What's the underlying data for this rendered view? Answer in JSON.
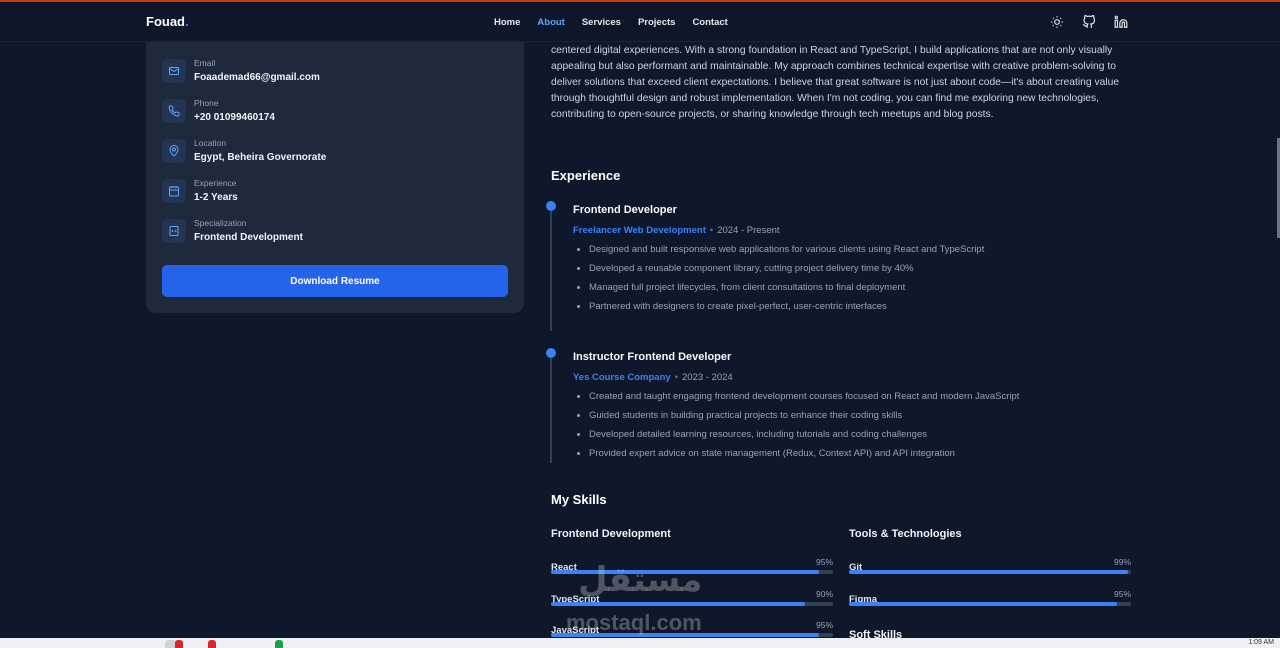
{
  "header": {
    "logo": "Fouad",
    "nav": [
      "Home",
      "About",
      "Services",
      "Projects",
      "Contact"
    ],
    "active_nav": "About",
    "icons": [
      "sun-icon",
      "github-icon",
      "linkedin-icon"
    ]
  },
  "contact": [
    {
      "label": "Email",
      "value": "Foaademad66@gmail.com",
      "icon": "mail-icon"
    },
    {
      "label": "Phone",
      "value": "+20 01099460174",
      "icon": "phone-icon"
    },
    {
      "label": "Location",
      "value": "Egypt, Beheira Governorate",
      "icon": "map-pin-icon"
    },
    {
      "label": "Experience",
      "value": "1-2 Years",
      "icon": "calendar-icon"
    },
    {
      "label": "Specialization",
      "value": "Frontend Development",
      "icon": "code-icon"
    }
  ],
  "download_button": "Download Resume",
  "bio": "centered digital experiences. With a strong foundation in React and TypeScript, I build applications that are not only visually appealing but also performant and maintainable. My approach combines technical expertise with creative problem-solving to deliver solutions that exceed client expectations. I believe that great software is not just about code—it's about creating value through thoughtful design and robust implementation. When I'm not coding, you can find me exploring new technologies, contributing to open-source projects, or sharing knowledge through tech meetups and blog posts.",
  "experience": {
    "heading": "Experience",
    "jobs": [
      {
        "title": "Frontend Developer",
        "company": "Freelancer Web Development",
        "period": "2024 - Present",
        "bullets": [
          "Designed and built responsive web applications for various clients using React and TypeScript",
          "Developed a reusable component library, cutting project delivery time by 40%",
          "Managed full project lifecycles, from client consultations to final deployment",
          "Partnered with designers to create pixel-perfect, user-centric interfaces"
        ]
      },
      {
        "title": "Instructor Frontend Developer",
        "company": "Yes Course Company",
        "period": "2023 - 2024",
        "bullets": [
          "Created and taught engaging frontend development courses focused on React and modern JavaScript",
          "Guided students in building practical projects to enhance their coding skills",
          "Developed detailed learning resources, including tutorials and coding challenges",
          "Provided expert advice on state management (Redux, Context API) and API integration"
        ]
      }
    ]
  },
  "skills": {
    "heading": "My Skills",
    "frontend": {
      "heading": "Frontend Development",
      "items": [
        {
          "name": "React",
          "percent": 95,
          "label": "95%"
        },
        {
          "name": "TypeScript",
          "percent": 90,
          "label": "90%"
        },
        {
          "name": "JavaScript",
          "percent": 95,
          "label": "95%"
        }
      ]
    },
    "tools": {
      "heading": "Tools & Technologies",
      "items": [
        {
          "name": "Git",
          "percent": 99,
          "label": "99%"
        },
        {
          "name": "Figma",
          "percent": 95,
          "label": "95%"
        }
      ]
    },
    "soft_heading": "Soft Skills"
  },
  "watermark": {
    "arabic": "مستقل",
    "latin": "mostaql.com"
  },
  "taskbar": {
    "clock": "1:09 AM"
  }
}
